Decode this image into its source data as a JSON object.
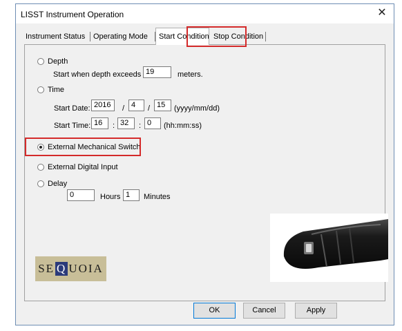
{
  "window": {
    "title": "LISST Instrument Operation",
    "close_symbol": "✕"
  },
  "tabs": [
    {
      "label": "Instrument Status"
    },
    {
      "label": "Operating Mode"
    },
    {
      "label": "Start Condition"
    },
    {
      "label": "Stop Condition"
    }
  ],
  "depth": {
    "label": "Depth",
    "text": "Start when depth exceeds",
    "value": "19",
    "unit": "meters."
  },
  "time": {
    "label": "Time",
    "start_date_label": "Start Date:",
    "year": "2016",
    "month": "4",
    "day": "15",
    "date_sep": "/",
    "date_format": "(yyyy/mm/dd)",
    "start_time_label": "Start Time:",
    "hour": "16",
    "minute": "32",
    "second": "0",
    "time_sep": ":",
    "time_format": "(hh:mm:ss)"
  },
  "external_mechanical_switch": {
    "label": "External Mechanical Switch",
    "checked": true
  },
  "external_digital_input": {
    "label": "External Digital Input"
  },
  "delay": {
    "label": "Delay",
    "hours_value": "0",
    "hours_label": "Hours",
    "minutes_value": "1",
    "minutes_label": "Minutes"
  },
  "logo": {
    "text_before": "SE",
    "q": "Q",
    "text_after": "UOIA"
  },
  "buttons": {
    "ok": "OK",
    "cancel": "Cancel",
    "apply": "Apply"
  },
  "colors": {
    "highlight_box": "#d42a2a",
    "window_border": "#6d8db3"
  }
}
